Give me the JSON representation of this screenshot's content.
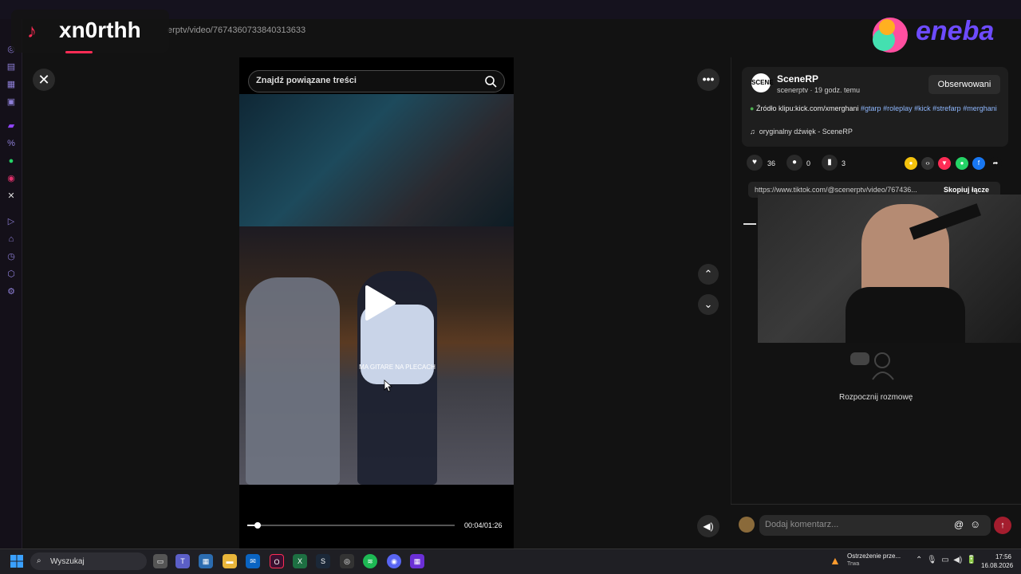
{
  "browser": {
    "url": "erptv/video/7674360733840313633"
  },
  "overlay": {
    "tiktok_user": "xn0rthh",
    "sponsor": "eneba"
  },
  "video": {
    "search_placeholder": "Znajdź powiązane treści",
    "subtitle": "MA GITARE NA PLECACH",
    "time": "00:04/01:26",
    "progress": 0.05
  },
  "post": {
    "author": "SceneRP",
    "avatar_text": "SCENE",
    "handle": "scenerptv · 19 godz. temu",
    "follow_label": "Obserwowani",
    "desc_prefix": "Źródło klipu:kick.com/xmerghani",
    "tags": [
      "#gtarp",
      "#roleplay",
      "#kick",
      "#strefarp",
      "#merghani"
    ],
    "sound": "oryginalny dźwięk - SceneRP",
    "likes": "36",
    "comments": "0",
    "saves": "3",
    "link": "https://www.tiktok.com/@scenerptv/video/767436...",
    "copy_label": "Skopiuj łącze"
  },
  "chat": {
    "start_label": "Rozpocznij rozmowę",
    "comment_placeholder": "Dodaj komentarz..."
  },
  "taskbar": {
    "search_label": "Wyszukaj",
    "warning_title": "Ostrzeżenie prze...",
    "warning_sub": "Trwa",
    "time": "17:56",
    "date": "16.08.2026"
  },
  "colors": {
    "accent": "#ff2c55",
    "tag": "#8fb8ff",
    "send": "#a41d2e"
  }
}
